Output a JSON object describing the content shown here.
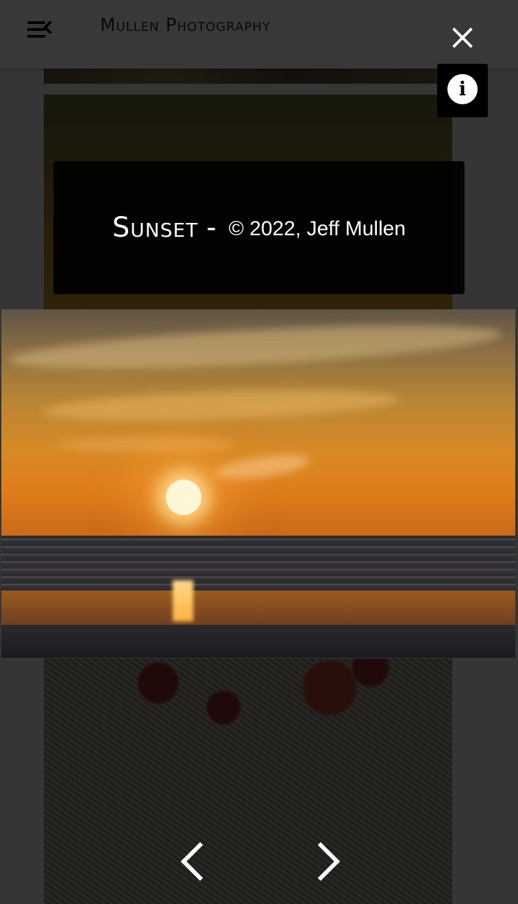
{
  "header": {
    "site_title": "Mullen Photography",
    "menu_icon": "menu-collapse-icon",
    "close_icon": "close-icon",
    "info_icon": "info-icon"
  },
  "lightbox": {
    "caption_title": "Sunset",
    "caption_separator": "-",
    "caption_copyright": "© 2022, Jeff Mullen",
    "prev_icon": "chevron-left-icon",
    "next_icon": "chevron-right-icon"
  },
  "colors": {
    "overlay": "#000000",
    "text": "#ffffff"
  }
}
